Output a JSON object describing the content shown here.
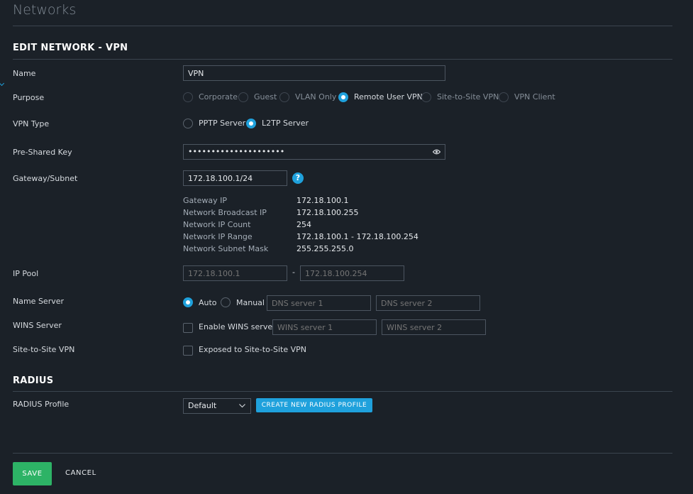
{
  "page_title": "Networks",
  "edit_section": {
    "title": "EDIT NETWORK - VPN"
  },
  "name": {
    "label": "Name",
    "value": "VPN"
  },
  "purpose": {
    "label": "Purpose",
    "options": [
      "Corporate",
      "Guest",
      "VLAN Only",
      "Remote User VPN",
      "Site-to-Site VPN",
      "VPN Client"
    ],
    "selected": "Remote User VPN"
  },
  "vpn_type": {
    "label": "VPN Type",
    "options": [
      "PPTP Server",
      "L2TP Server"
    ],
    "selected": "L2TP Server"
  },
  "psk": {
    "label": "Pre-Shared Key",
    "value": "•••••••••••••••••••••",
    "icon": "eye-icon"
  },
  "gateway": {
    "label": "Gateway/Subnet",
    "value": "172.18.100.1/24",
    "help": "?"
  },
  "network_info": [
    {
      "key": "Gateway IP",
      "value": "172.18.100.1"
    },
    {
      "key": "Network Broadcast IP",
      "value": "172.18.100.255"
    },
    {
      "key": "Network IP Count",
      "value": "254"
    },
    {
      "key": "Network IP Range",
      "value": "172.18.100.1 - 172.18.100.254"
    },
    {
      "key": "Network Subnet Mask",
      "value": "255.255.255.0"
    }
  ],
  "ip_pool": {
    "label": "IP Pool",
    "start_placeholder": "172.18.100.1",
    "separator": "-",
    "end_placeholder": "172.18.100.254"
  },
  "name_server": {
    "label": "Name Server",
    "options": [
      "Auto",
      "Manual"
    ],
    "selected": "Auto",
    "dns1_placeholder": "DNS server 1",
    "dns2_placeholder": "DNS server 2"
  },
  "wins_server": {
    "label": "WINS Server",
    "checkbox_label": "Enable WINS server",
    "checked": false,
    "wins1_placeholder": "WINS server 1",
    "wins2_placeholder": "WINS server 2"
  },
  "site_to_site": {
    "label": "Site-to-Site VPN",
    "checkbox_label": "Exposed to Site-to-Site VPN",
    "checked": false
  },
  "radius_section": {
    "title": "RADIUS"
  },
  "radius_profile": {
    "label": "RADIUS Profile",
    "selected": "Default",
    "create_button": "CREATE NEW RADIUS PROFILE"
  },
  "actions": {
    "save": "SAVE",
    "cancel": "CANCEL"
  },
  "colors": {
    "accent": "#1fa1dc",
    "save": "#2db366",
    "background": "#1b2128"
  }
}
